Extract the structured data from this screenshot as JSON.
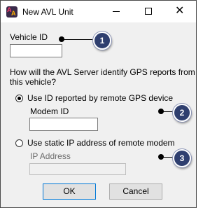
{
  "window": {
    "title": "New AVL Unit",
    "controls": {
      "minimize": "minimize-icon",
      "maximize": "maximize-icon",
      "close": "close-icon"
    }
  },
  "form": {
    "vehicle_id_label": "Vehicle ID",
    "vehicle_id_value": "",
    "question_line1": "How will the AVL Server identify GPS reports from",
    "question_line2": "this vehicle?",
    "option_id": {
      "label": "Use ID reported by remote GPS device",
      "selected": true
    },
    "modem_id_label": "Modem ID",
    "modem_id_value": "",
    "option_static_ip": {
      "label": "Use static IP address of remote modem",
      "selected": false
    },
    "ip_address_label": "IP Address",
    "ip_address_value": ""
  },
  "buttons": {
    "ok": "OK",
    "cancel": "Cancel"
  },
  "callouts": [
    "1",
    "2",
    "3"
  ],
  "colors": {
    "callout_fill": "#2f3f6f",
    "default_button_border": "#0078d7"
  }
}
